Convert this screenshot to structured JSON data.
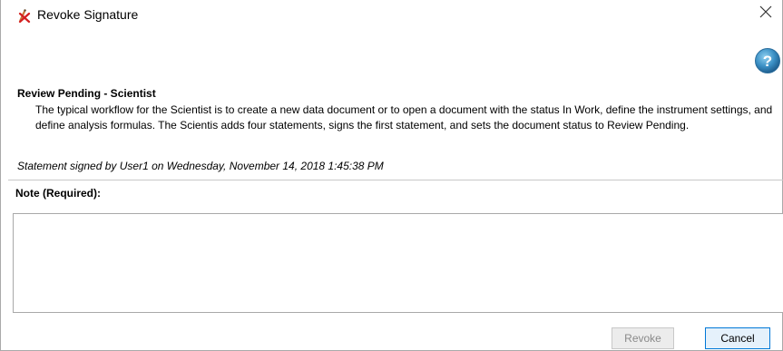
{
  "window": {
    "title": "Revoke Signature",
    "title_icon": "signature-revoke-icon",
    "close_icon": "close-icon",
    "help_icon": "help-icon"
  },
  "statement": {
    "heading": "Review Pending - Scientist",
    "description": "The typical workflow for the Scientist is to create a new data document or to open a document with the status In Work, define the instrument settings, and define analysis formulas. The Scientis adds four statements, signs the first statement, and sets the document status to Review Pending.",
    "signed_by": "Statement signed by User1 on Wednesday, November 14, 2018 1:45:38 PM"
  },
  "note": {
    "label": "Note (Required):",
    "value": ""
  },
  "buttons": {
    "revoke_label": "Revoke",
    "cancel_label": "Cancel"
  },
  "colors": {
    "help_icon": "#3a8fc4",
    "accent_border": "#0078d7"
  }
}
